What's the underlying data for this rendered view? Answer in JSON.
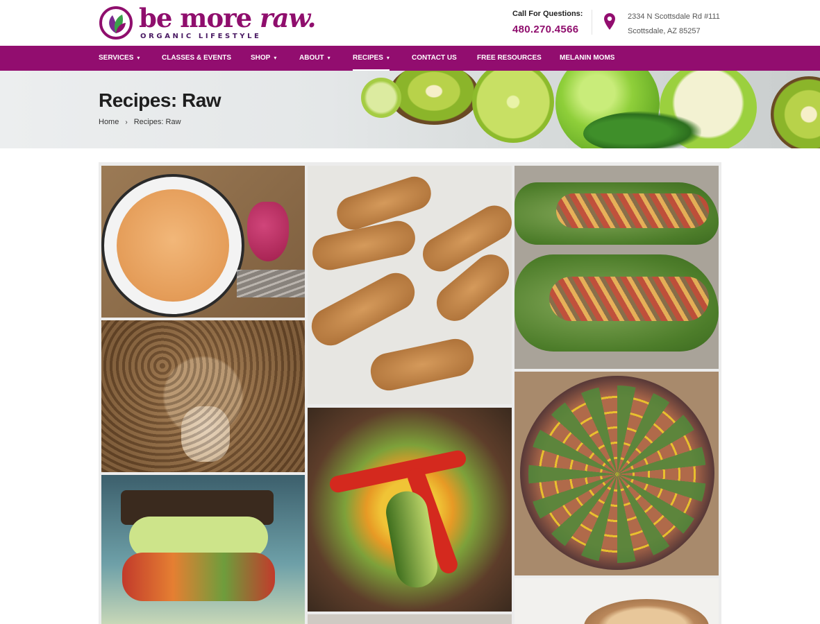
{
  "brand": {
    "name_part1": "be more ",
    "name_part2": "raw.",
    "tagline": "ORGANIC LIFESTYLE",
    "primary_color": "#920d6f",
    "dark_purple": "#4a1a63",
    "leaf_green": "#3aa04a"
  },
  "contact": {
    "call_label": "Call For Questions:",
    "phone": "480.270.4566",
    "address_line1": "2334 N Scottsdale Rd #111",
    "address_line2": "Scottsdale, AZ 85257",
    "icon": "map-pin-icon"
  },
  "nav": {
    "items": [
      {
        "label": "SERVICES",
        "has_dropdown": true
      },
      {
        "label": "CLASSES & EVENTS",
        "has_dropdown": false
      },
      {
        "label": "SHOP",
        "has_dropdown": true
      },
      {
        "label": "ABOUT",
        "has_dropdown": true
      },
      {
        "label": "RECIPES",
        "has_dropdown": true,
        "active": true
      },
      {
        "label": "CONTACT US",
        "has_dropdown": false
      },
      {
        "label": "FREE RESOURCES",
        "has_dropdown": false
      },
      {
        "label": "MELANIN MOMS",
        "has_dropdown": false
      }
    ],
    "caret": "▾"
  },
  "page": {
    "title": "Recipes: Raw",
    "breadcrumb": {
      "home": "Home",
      "separator": "›",
      "current": "Recipes: Raw"
    }
  },
  "gallery": {
    "items": [
      {
        "name": "soup-bowl-photo"
      },
      {
        "name": "crusted-rolls-photo"
      },
      {
        "name": "lettuce-wraps-photo"
      },
      {
        "name": "walnut-meat-processor-photo"
      },
      {
        "name": "veggie-pizza-peppers-photo"
      },
      {
        "name": "arugula-pizza-photo"
      },
      {
        "name": "sandwich-photo"
      },
      {
        "name": "plate-photo"
      },
      {
        "name": "hummus-bowl-photo"
      }
    ]
  }
}
